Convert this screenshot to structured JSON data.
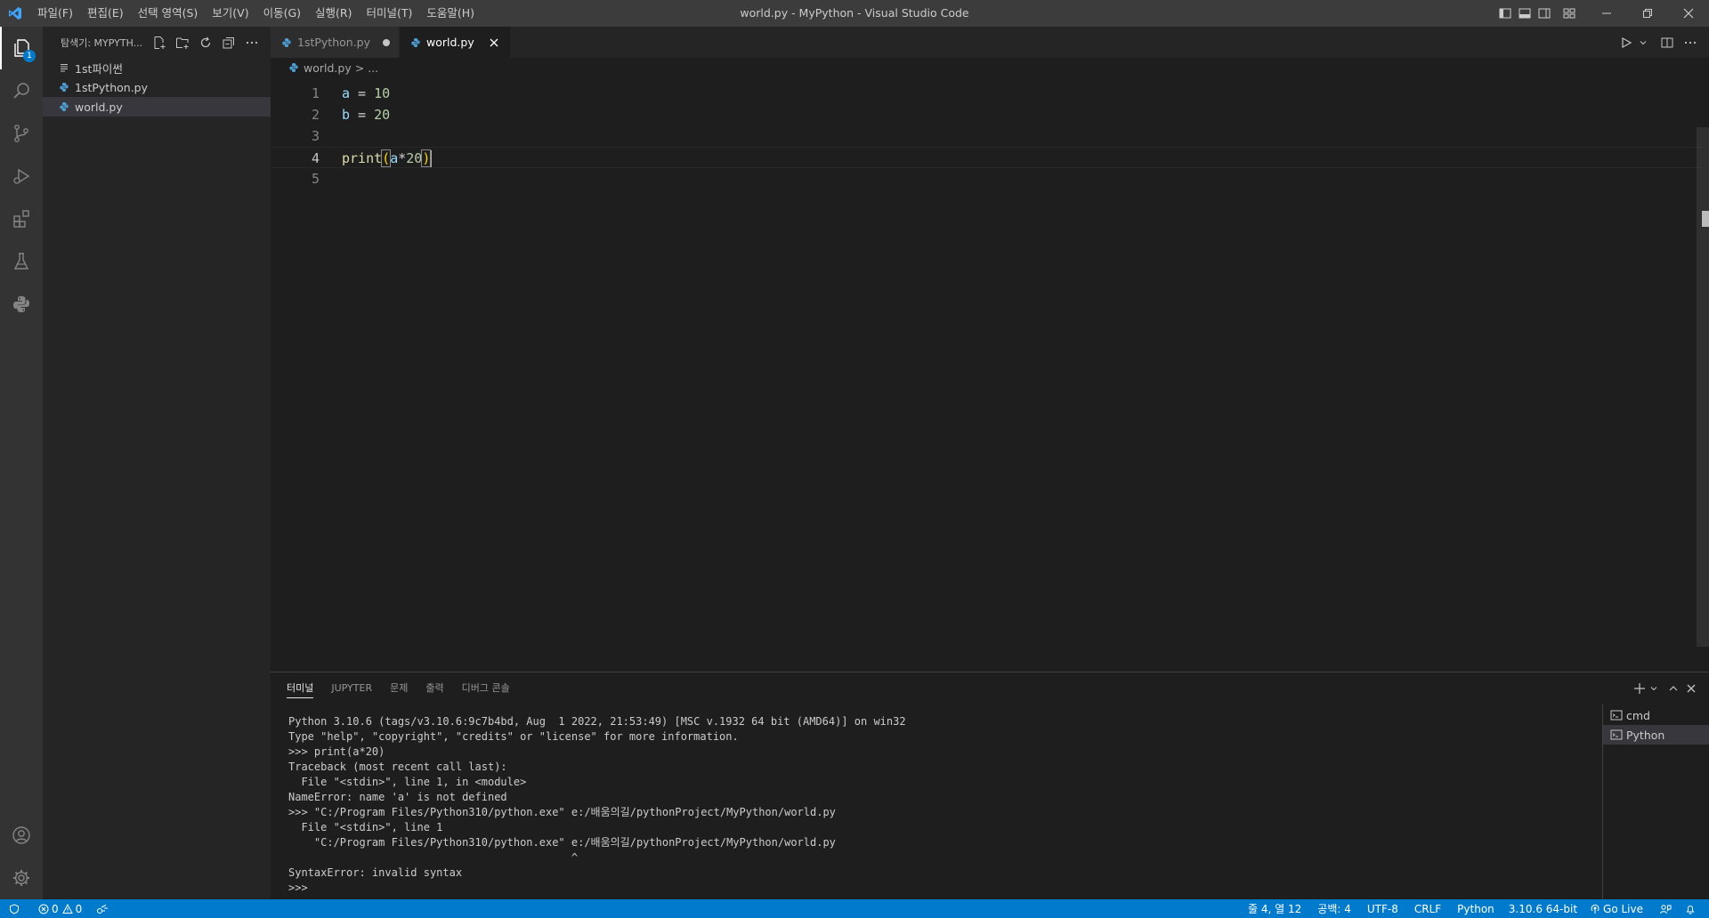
{
  "app": {
    "window_title": "world.py - MyPython - Visual Studio Code",
    "menu": [
      "파일(F)",
      "편집(E)",
      "선택 영역(S)",
      "보기(V)",
      "이동(G)",
      "실행(R)",
      "터미널(T)",
      "도움말(H)"
    ]
  },
  "activity_bar": {
    "explorer_badge": "1"
  },
  "sidebar": {
    "title": "탐색기: MYPYTH...",
    "items": [
      {
        "label": "1st파이썬",
        "icon": "file-lines-icon"
      },
      {
        "label": "1stPython.py",
        "icon": "python-file-icon"
      },
      {
        "label": "world.py",
        "icon": "python-file-icon"
      }
    ]
  },
  "editor": {
    "tabs": [
      {
        "label": "1stPython.py",
        "dirty": true
      },
      {
        "label": "world.py",
        "active": true
      }
    ],
    "breadcrumb": {
      "file": "world.py",
      "separator": ">",
      "rest": "..."
    },
    "line_numbers": [
      "1",
      "2",
      "3",
      "4",
      "5"
    ],
    "lines": [
      {
        "var": "a",
        "op": " = ",
        "num": "10"
      },
      {
        "var": "b",
        "op": " = ",
        "num": "20"
      },
      {},
      {
        "fn": "print",
        "open": "(",
        "var": "a",
        "op": "*",
        "num": "20",
        "close": ")"
      },
      {}
    ],
    "current_line": "4"
  },
  "panel": {
    "tabs": [
      "터미널",
      "JUPYTER",
      "문제",
      "출력",
      "디버그 콘솔"
    ],
    "terminal_lines": [
      "Python 3.10.6 (tags/v3.10.6:9c7b4bd, Aug  1 2022, 21:53:49) [MSC v.1932 64 bit (AMD64)] on win32",
      "Type \"help\", \"copyright\", \"credits\" or \"license\" for more information.",
      ">>> print(a*20)",
      "Traceback (most recent call last):",
      "  File \"<stdin>\", line 1, in <module>",
      "NameError: name 'a' is not defined",
      ">>> \"C:/Program Files/Python310/python.exe\" e:/배움의길/pythonProject/MyPython/world.py",
      "  File \"<stdin>\", line 1",
      "    \"C:/Program Files/Python310/python.exe\" e:/배움의길/pythonProject/MyPython/world.py",
      "                                            ^",
      "SyntaxError: invalid syntax",
      ">>>"
    ],
    "terminals": [
      {
        "label": "cmd"
      },
      {
        "label": "Python",
        "selected": true
      }
    ]
  },
  "statusbar": {
    "errors": "0",
    "warnings": "0",
    "position": "줄 4, 열 12",
    "spaces": "공백: 4",
    "encoding": "UTF-8",
    "eol": "CRLF",
    "language": "Python",
    "interpreter": "3.10.6 64-bit",
    "go_live": "Go Live"
  },
  "colors": {
    "accent": "#007acc",
    "python_icon": "#4d9fd6"
  }
}
